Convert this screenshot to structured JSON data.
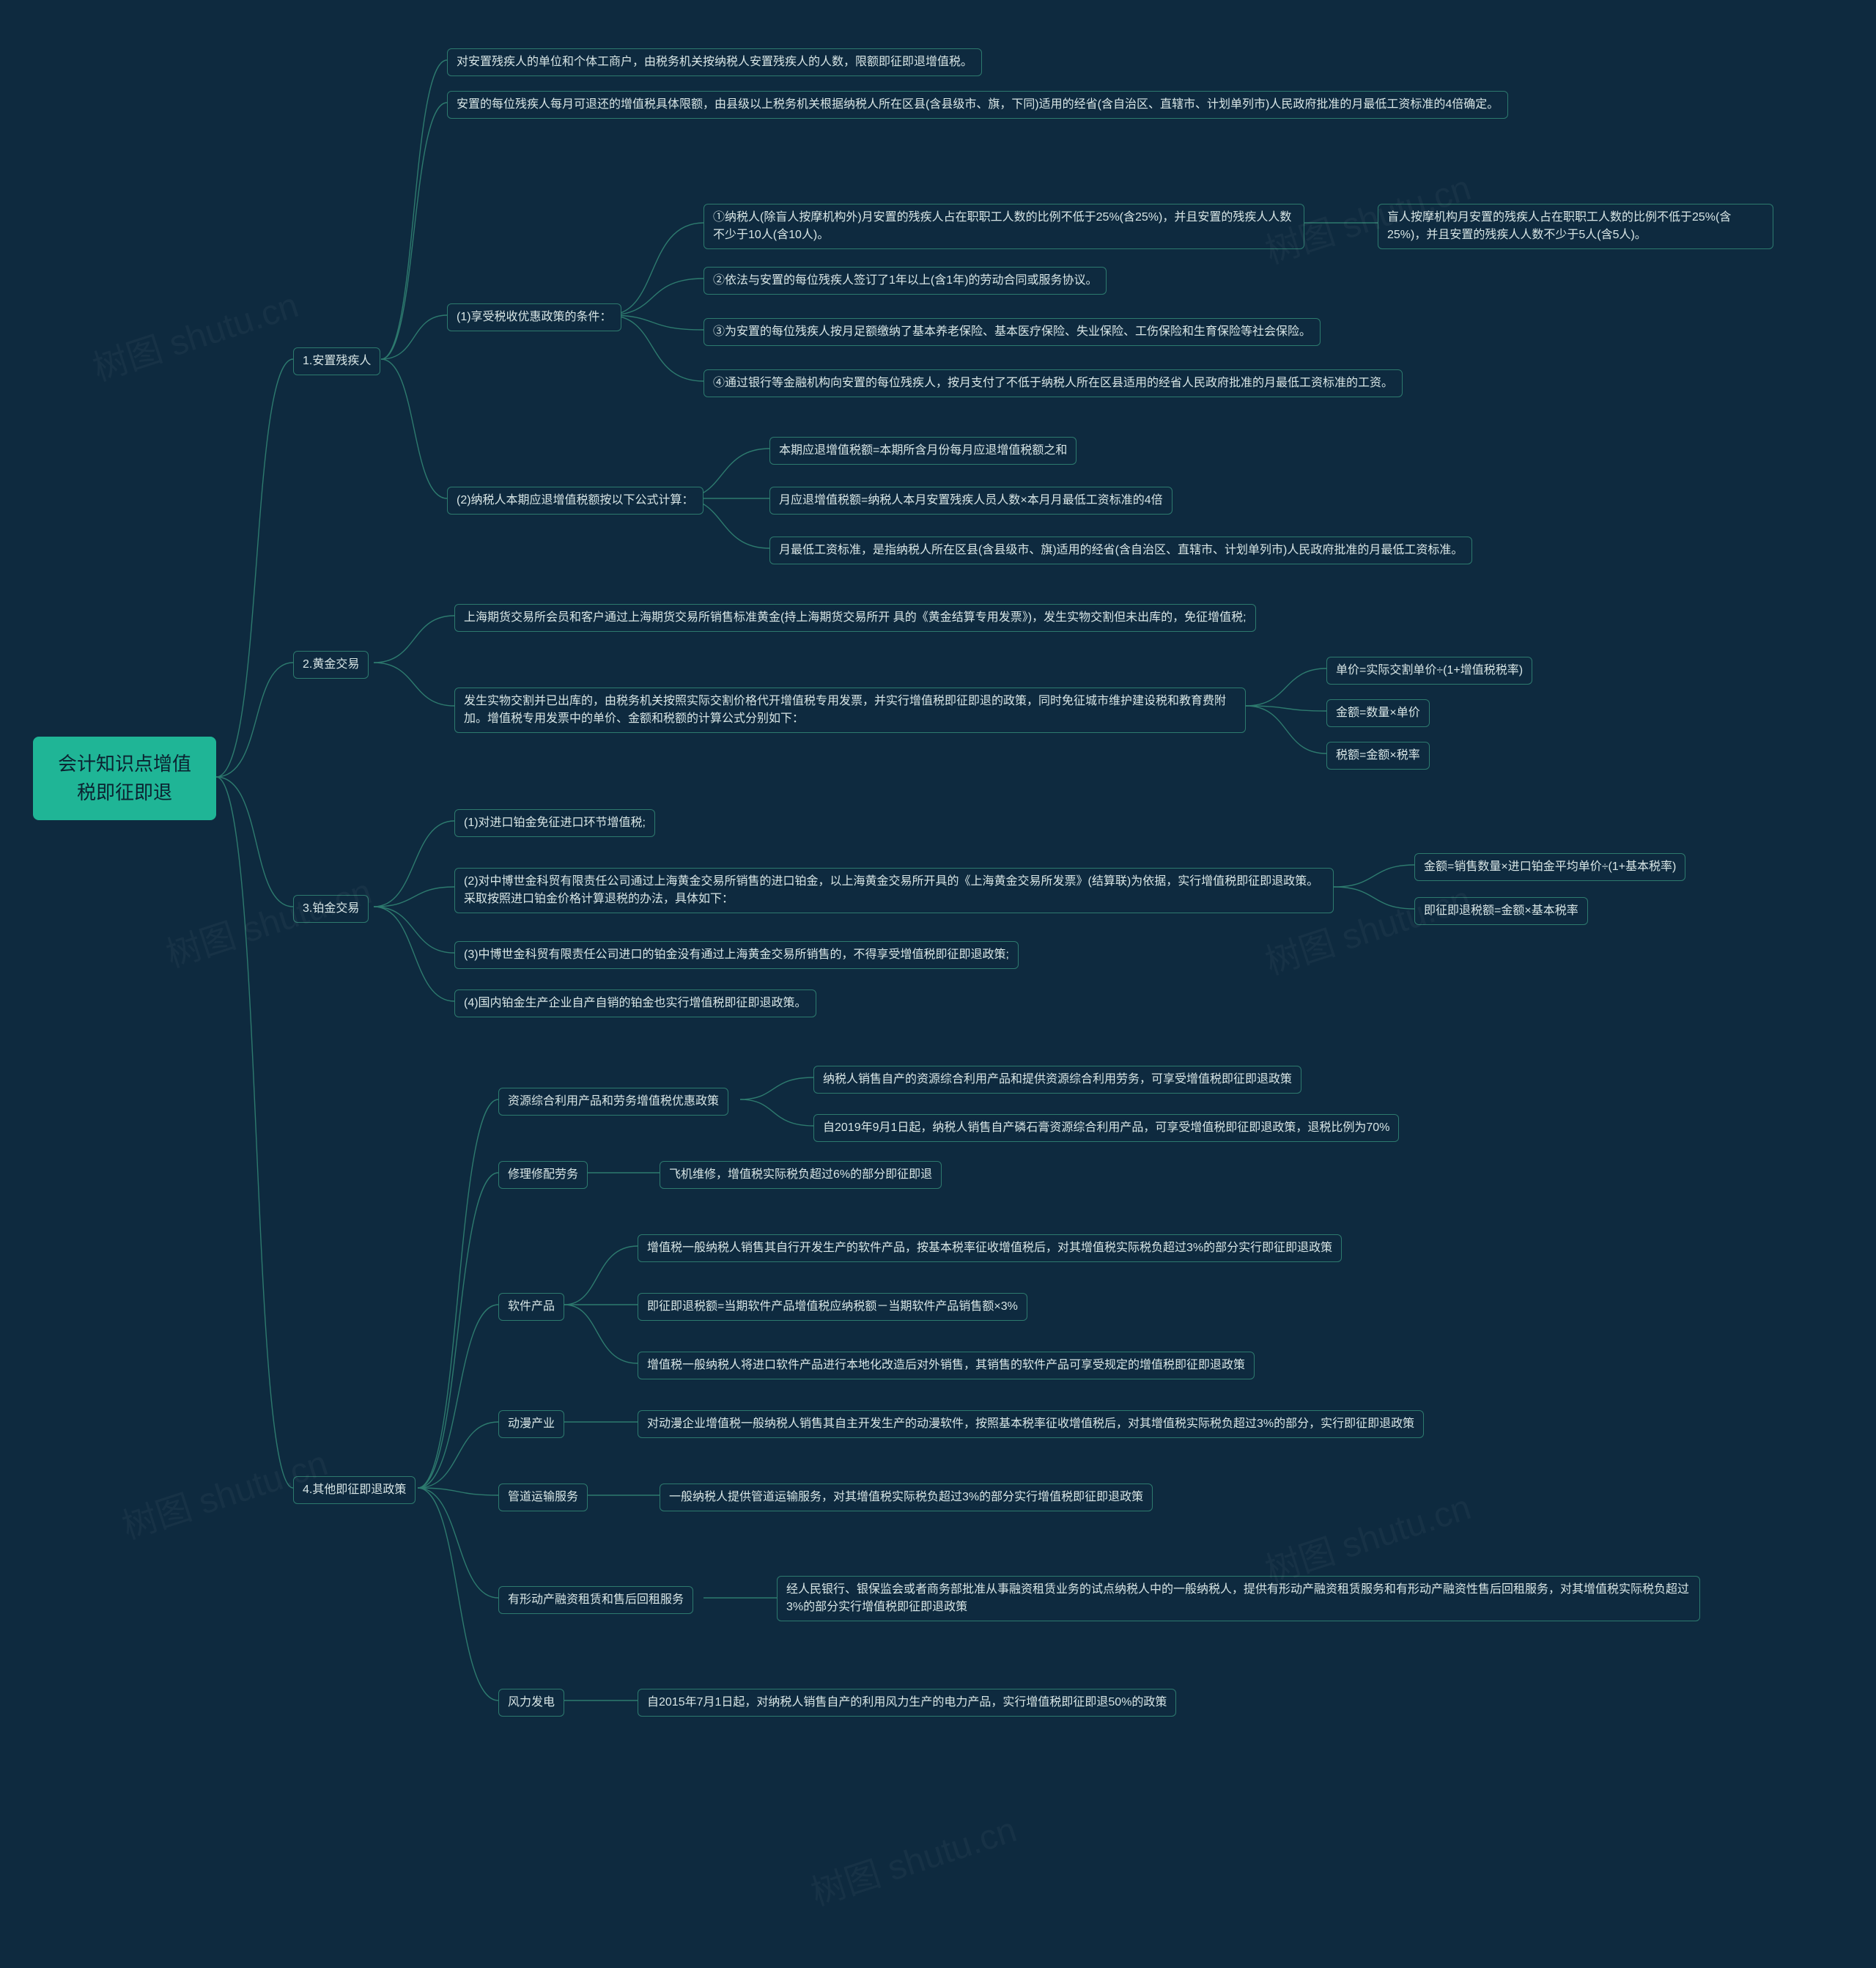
{
  "root": "会计知识点增值税即征即退",
  "watermark": "树图 shutu.cn",
  "n1": "1.安置残疾人",
  "n1_1": "对安置残疾人的单位和个体工商户，由税务机关按纳税人安置残疾人的人数，限额即征即退增值税。",
  "n1_2": "安置的每位残疾人每月可退还的增值税具体限额，由县级以上税务机关根据纳税人所在区县(含县级市、旗，下同)适用的经省(含自治区、直辖市、计划单列市)人民政府批准的月最低工资标准的4倍确定。",
  "n1_3": "(1)享受税收优惠政策的条件：",
  "n1_3_1": "①纳税人(除盲人按摩机构外)月安置的残疾人占在职职工人数的比例不低于25%(含25%)，并且安置的残疾人人数不少于10人(含10人)。",
  "n1_3_1_a": "盲人按摩机构月安置的残疾人占在职职工人数的比例不低于25%(含25%)，并且安置的残疾人人数不少于5人(含5人)。",
  "n1_3_2": "②依法与安置的每位残疾人签订了1年以上(含1年)的劳动合同或服务协议。",
  "n1_3_3": "③为安置的每位残疾人按月足额缴纳了基本养老保险、基本医疗保险、失业保险、工伤保险和生育保险等社会保险。",
  "n1_3_4": "④通过银行等金融机构向安置的每位残疾人，按月支付了不低于纳税人所在区县适用的经省人民政府批准的月最低工资标准的工资。",
  "n1_4": "(2)纳税人本期应退增值税额按以下公式计算：",
  "n1_4_1": "本期应退增值税额=本期所含月份每月应退增值税额之和",
  "n1_4_2": "月应退增值税额=纳税人本月安置残疾人员人数×本月月最低工资标准的4倍",
  "n1_4_3": "月最低工资标准，是指纳税人所在区县(含县级市、旗)适用的经省(含自治区、直辖市、计划单列市)人民政府批准的月最低工资标准。",
  "n2": "2.黄金交易",
  "n2_1": "上海期货交易所会员和客户通过上海期货交易所销售标准黄金(持上海期货交易所开 具的《黄金结算专用发票》)，发生实物交割但未出库的，免征增值税;",
  "n2_2": "发生实物交割并已出库的，由税务机关按照实际交割价格代开增值税专用发票，并实行增值税即征即退的政策，同时免征城市维护建设税和教育费附加。增值税专用发票中的单价、金额和税额的计算公式分别如下：",
  "n2_2_1": "单价=实际交割单价÷(1+增值税税率)",
  "n2_2_2": "金额=数量×单价",
  "n2_2_3": "税额=金额×税率",
  "n3": "3.铂金交易",
  "n3_1": "(1)对进口铂金免征进口环节增值税;",
  "n3_2": "(2)对中博世金科贸有限责任公司通过上海黄金交易所销售的进口铂金，以上海黄金交易所开具的《上海黄金交易所发票》(结算联)为依据，实行增值税即征即退政策。采取按照进口铂金价格计算退税的办法，具体如下：",
  "n3_2_1": "金额=销售数量×进口铂金平均单价÷(1+基本税率)",
  "n3_2_2": "即征即退税额=金额×基本税率",
  "n3_3": "(3)中博世金科贸有限责任公司进口的铂金没有通过上海黄金交易所销售的，不得享受增值税即征即退政策;",
  "n3_4": "(4)国内铂金生产企业自产自销的铂金也实行增值税即征即退政策。",
  "n4": "4.其他即征即退政策",
  "n4_1": "资源综合利用产品和劳务增值税优惠政策",
  "n4_1_1": "纳税人销售自产的资源综合利用产品和提供资源综合利用劳务，可享受增值税即征即退政策",
  "n4_1_2": "自2019年9月1日起，纳税人销售自产磷石膏资源综合利用产品，可享受增值税即征即退政策，退税比例为70%",
  "n4_2": "修理修配劳务",
  "n4_2_1": "飞机维修，增值税实际税负超过6%的部分即征即退",
  "n4_3": "软件产品",
  "n4_3_1": "增值税一般纳税人销售其自行开发生产的软件产品，按基本税率征收增值税后，对其增值税实际税负超过3%的部分实行即征即退政策",
  "n4_3_2": "即征即退税额=当期软件产品增值税应纳税额－当期软件产品销售额×3%",
  "n4_3_3": "增值税一般纳税人将进口软件产品进行本地化改造后对外销售，其销售的软件产品可享受规定的增值税即征即退政策",
  "n4_4": "动漫产业",
  "n4_4_1": "对动漫企业增值税一般纳税人销售其自主开发生产的动漫软件，按照基本税率征收增值税后，对其增值税实际税负超过3%的部分，实行即征即退政策",
  "n4_5": "管道运输服务",
  "n4_5_1": "一般纳税人提供管道运输服务，对其增值税实际税负超过3%的部分实行增值税即征即退政策",
  "n4_6": "有形动产融资租赁和售后回租服务",
  "n4_6_1": "经人民银行、银保监会或者商务部批准从事融资租赁业务的试点纳税人中的一般纳税人，提供有形动产融资租赁服务和有形动产融资性售后回租服务，对其增值税实际税负超过3%的部分实行增值税即征即退政策",
  "n4_7": "风力发电",
  "n4_7_1": "自2015年7月1日起，对纳税人销售自产的利用风力生产的电力产品，实行增值税即征即退50%的政策"
}
